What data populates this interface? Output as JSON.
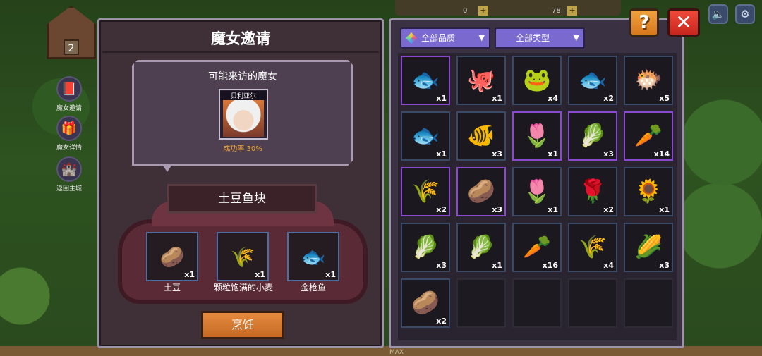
{
  "topbar": {
    "resource_1_count": "0",
    "resource_2_count": "78"
  },
  "house": {
    "level": "2"
  },
  "sidebar": {
    "items": [
      {
        "label": "魔女邀请",
        "icon": "heart-book-icon"
      },
      {
        "label": "魔女详情",
        "icon": "witch-details-icon"
      },
      {
        "label": "返回主城",
        "icon": "castle-icon"
      }
    ]
  },
  "buttons": {
    "help": "?",
    "close": "✕",
    "cook": "烹饪"
  },
  "left_panel": {
    "title": "魔女邀请",
    "bubble_title": "可能来访的魔女",
    "witch": {
      "name": "贝利亚尔",
      "success_rate": "成功率 30%"
    },
    "dish_name": "土豆鱼块",
    "ingredients": [
      {
        "name": "土豆",
        "qty": "x1",
        "icon": "potato-icon",
        "glyph": "🥔"
      },
      {
        "name": "颗粒饱满的小麦",
        "qty": "x1",
        "icon": "wheat-icon",
        "glyph": "🌾"
      },
      {
        "name": "金枪鱼",
        "qty": "x1",
        "icon": "tuna-icon",
        "glyph": "🐟"
      }
    ]
  },
  "right_panel": {
    "filters": {
      "quality": "全部品质",
      "type": "全部类型"
    },
    "inventory": [
      {
        "icon": "blue-fish-icon",
        "glyph": "🐟",
        "qty": "x1",
        "rare": true
      },
      {
        "icon": "octopus-icon",
        "glyph": "🐙",
        "qty": "x1",
        "rare": false
      },
      {
        "icon": "frog-icon",
        "glyph": "🐸",
        "qty": "x4",
        "rare": false
      },
      {
        "icon": "tuna-icon",
        "glyph": "🐟",
        "qty": "x2",
        "rare": false
      },
      {
        "icon": "pufferfish-icon",
        "glyph": "🐡",
        "qty": "x5",
        "rare": false
      },
      {
        "icon": "catfish-icon",
        "glyph": "🐟",
        "qty": "x1",
        "rare": false
      },
      {
        "icon": "goldfish-icon",
        "glyph": "🐠",
        "qty": "x3",
        "rare": false
      },
      {
        "icon": "blue-flower-icon",
        "glyph": "🌷",
        "qty": "x1",
        "rare": true
      },
      {
        "icon": "lettuce-icon",
        "glyph": "🥬",
        "qty": "x3",
        "rare": true
      },
      {
        "icon": "carrot-icon",
        "glyph": "🥕",
        "qty": "x14",
        "rare": true
      },
      {
        "icon": "wheat-icon",
        "glyph": "🌾",
        "qty": "x2",
        "rare": true
      },
      {
        "icon": "potato-icon",
        "glyph": "🥔",
        "qty": "x3",
        "rare": true
      },
      {
        "icon": "blue-flower-icon",
        "glyph": "🌷",
        "qty": "x1",
        "rare": false
      },
      {
        "icon": "red-flower-icon",
        "glyph": "🌹",
        "qty": "x2",
        "rare": false
      },
      {
        "icon": "sunflower-icon",
        "glyph": "🌻",
        "qty": "x1",
        "rare": false
      },
      {
        "icon": "bok-choy-icon",
        "glyph": "🥬",
        "qty": "x3",
        "rare": false
      },
      {
        "icon": "lettuce-icon",
        "glyph": "🥬",
        "qty": "x1",
        "rare": false
      },
      {
        "icon": "carrot-icon",
        "glyph": "🥕",
        "qty": "x16",
        "rare": false
      },
      {
        "icon": "wheat-icon",
        "glyph": "🌾",
        "qty": "x4",
        "rare": false
      },
      {
        "icon": "corn-icon",
        "glyph": "🌽",
        "qty": "x3",
        "rare": false
      },
      {
        "icon": "potato-icon",
        "glyph": "🥔",
        "qty": "x2",
        "rare": false
      },
      {
        "icon": null,
        "glyph": "",
        "qty": "",
        "rare": false
      },
      {
        "icon": null,
        "glyph": "",
        "qty": "",
        "rare": false
      },
      {
        "icon": null,
        "glyph": "",
        "qty": "",
        "rare": false
      },
      {
        "icon": null,
        "glyph": "",
        "qty": "",
        "rare": false
      }
    ]
  },
  "footer": {
    "max_label": "MAX"
  }
}
